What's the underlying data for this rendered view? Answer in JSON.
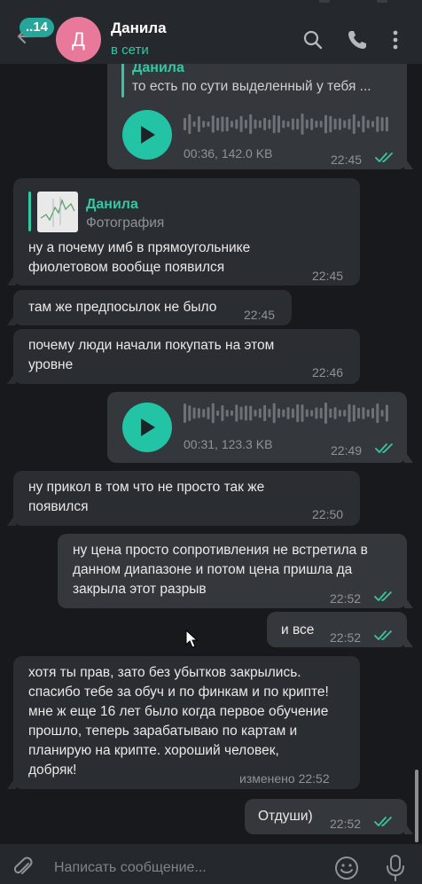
{
  "header": {
    "unread_count": "..14",
    "avatar_letter": "Д",
    "contact_name": "Данила",
    "status": "в сети",
    "icons": [
      "back-arrow-icon",
      "search-icon",
      "phone-icon",
      "more-vertical-icon"
    ]
  },
  "messages": [
    {
      "id": "m1",
      "side": "out",
      "type": "voice",
      "reply": {
        "name": "Данила",
        "text": "то есть по сути выделенный у тебя ..."
      },
      "meta": "00:36, 142.0 KB",
      "time": "22:45",
      "read": true
    },
    {
      "id": "m2",
      "side": "in",
      "type": "text",
      "reply": {
        "name": "Данила",
        "kind": "Фотография"
      },
      "text": "ну а почему имб в прямоугольнике фиолетовом вообще появился",
      "time": "22:45"
    },
    {
      "id": "m3",
      "side": "in",
      "type": "text",
      "text": "там же предпосылок не было",
      "time": "22:45"
    },
    {
      "id": "m4",
      "side": "in",
      "type": "text",
      "text": "почему люди начали покупать на этом уровне",
      "time": "22:46"
    },
    {
      "id": "m5",
      "side": "out",
      "type": "voice",
      "meta": "00:31, 123.3 KB",
      "time": "22:49",
      "read": true
    },
    {
      "id": "m6",
      "side": "in",
      "type": "text",
      "text": "ну прикол в том что не просто так же появился",
      "time": "22:50"
    },
    {
      "id": "m7",
      "side": "out",
      "type": "text",
      "text": "ну цена просто сопротивления не встретила в данном диапазоне и потом цена пришла да закрыла этот разрыв",
      "time": "22:52",
      "read": true
    },
    {
      "id": "m8",
      "side": "out",
      "type": "text",
      "text": "и все",
      "time": "22:52",
      "read": true
    },
    {
      "id": "m9",
      "side": "in",
      "type": "text",
      "text": "хотя ты прав, зато без убытков закрылись. спасибо тебе за обуч и по финкам и по крипте! мне ж еще 16 лет было когда первое обучение прошло, теперь зарабатываю по картам и планирую на крипте. хороший человек, добряк!",
      "time": "изменено 22:52"
    },
    {
      "id": "m10",
      "side": "out",
      "type": "text",
      "text": "Отдуши)",
      "time": "22:52",
      "read": true
    }
  ],
  "composer": {
    "placeholder": "Написать сообщение...",
    "icons": [
      "attach-icon",
      "emoji-icon",
      "microphone-icon"
    ]
  },
  "colors": {
    "accent": "#34c7a4",
    "play": "#23c4a6",
    "avatar": "#e9799b",
    "background": "#17191c"
  }
}
